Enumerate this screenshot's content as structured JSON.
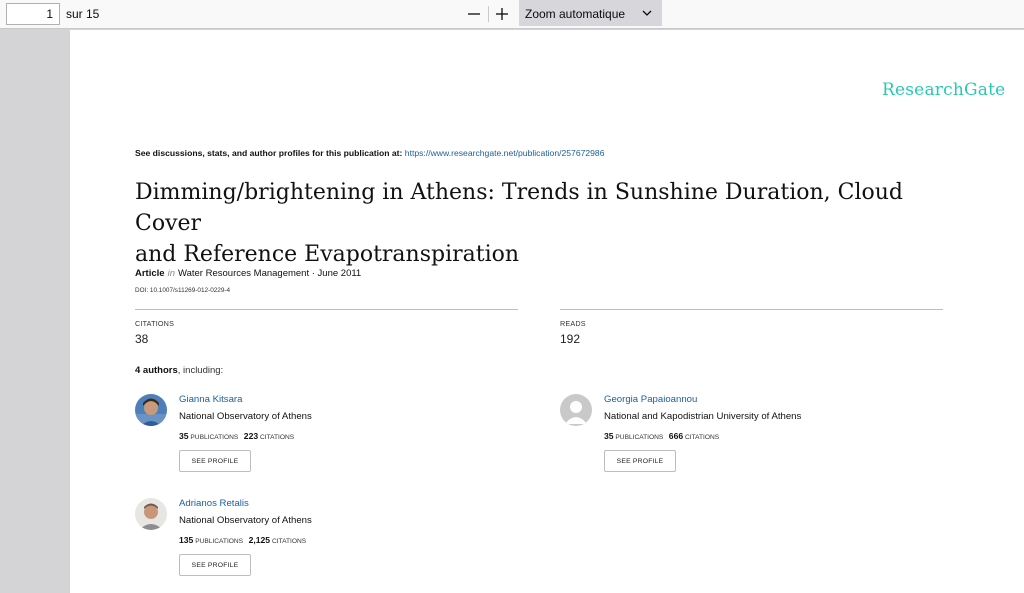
{
  "toolbar": {
    "page_number": "1",
    "page_total": "sur 15",
    "zoom_label": "Zoom automatique"
  },
  "document": {
    "logo": "ResearchGate",
    "see_discussions": "See discussions, stats, and author profiles for this publication at:",
    "see_discussions_url": "https://www.researchgate.net/publication/257672986",
    "title_line1": "Dimming/brightening in Athens: Trends in Sunshine Duration, Cloud Cover",
    "title_line2": "and Reference Evapotranspiration",
    "article_type": "Article",
    "article_in": "in",
    "article_source": "Water Resources Management · June 2011",
    "doi": "DOI: 10.1007/s11269-012-0229-4",
    "citations_label": "CITATIONS",
    "citations_value": "38",
    "reads_label": "READS",
    "reads_value": "192",
    "authors_count": "4 authors",
    "authors_suffix": ", including:"
  },
  "authors": [
    {
      "name": "Gianna Kitsara",
      "institution": "National Observatory of Athens",
      "publications": "35",
      "publications_label": "PUBLICATIONS",
      "citations": "223",
      "citations_label": "CITATIONS",
      "button": "SEE PROFILE"
    },
    {
      "name": "Georgia Papaioannou",
      "institution": "National and Kapodistrian University of Athens",
      "publications": "35",
      "publications_label": "PUBLICATIONS",
      "citations": "666",
      "citations_label": "CITATIONS",
      "button": "SEE PROFILE"
    },
    {
      "name": "Adrianos Retalis",
      "institution": "National Observatory of Athens",
      "publications": "135",
      "publications_label": "PUBLICATIONS",
      "citations": "2,125",
      "citations_label": "CITATIONS",
      "button": "SEE PROFILE"
    }
  ],
  "colors": {
    "accent": "#27c9b1",
    "link": "#1a5e9c"
  }
}
